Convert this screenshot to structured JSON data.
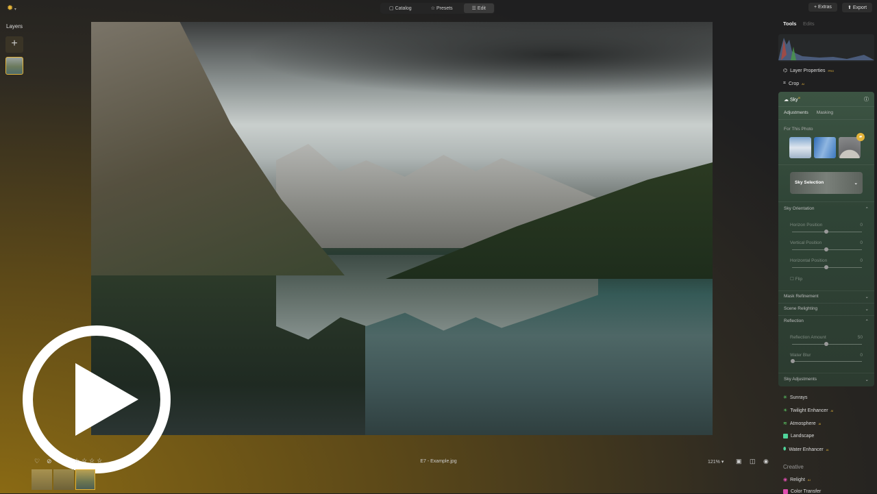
{
  "app": {
    "logo": "sun-logo"
  },
  "nav": {
    "catalog": "Catalog",
    "presets": "Presets",
    "edit": "Edit"
  },
  "top_right": {
    "extras": "Extras",
    "export": "Export"
  },
  "layers": {
    "title": "Layers",
    "add": "+"
  },
  "tools_tabs": {
    "tools": "Tools",
    "edits": "Edits"
  },
  "tools": {
    "layer_properties": "Layer Properties",
    "crop": "Crop",
    "badge_pro": "PRO",
    "badge_ai": "AI"
  },
  "sky": {
    "title": "Sky",
    "tabs": [
      "Adjustments",
      "Masking"
    ],
    "for_this_photo": "For This Photo",
    "sky_selection": "Sky Selection",
    "orientation": {
      "title": "Sky Orientation",
      "horizon": {
        "label": "Horizon Position",
        "value": 0
      },
      "vertical": {
        "label": "Vertical Position",
        "value": 0
      },
      "horizontal": {
        "label": "Horizontal Position",
        "value": 0
      },
      "flip": "Flip"
    },
    "mask_refinement": "Mask Refinement",
    "scene_relighting": "Scene Relighting",
    "reflection": {
      "title": "Reflection",
      "amount": {
        "label": "Reflection Amount",
        "value": 50
      },
      "water_blur": {
        "label": "Water Blur",
        "value": 0
      }
    },
    "sky_adjustments": "Sky Adjustments"
  },
  "more_tools": [
    "Sunrays",
    "Twilight Enhancer",
    "Atmosphere",
    "Landscape",
    "Water Enhancer"
  ],
  "creative": {
    "title": "Creative",
    "items": [
      "Relight",
      "Color Transfer"
    ]
  },
  "bottom": {
    "filename": "E7 - Example.jpg",
    "zoom": "121%",
    "rating_stars": 0
  },
  "colors": {
    "accent": "#e4b43a",
    "panel": "#3c5443"
  }
}
